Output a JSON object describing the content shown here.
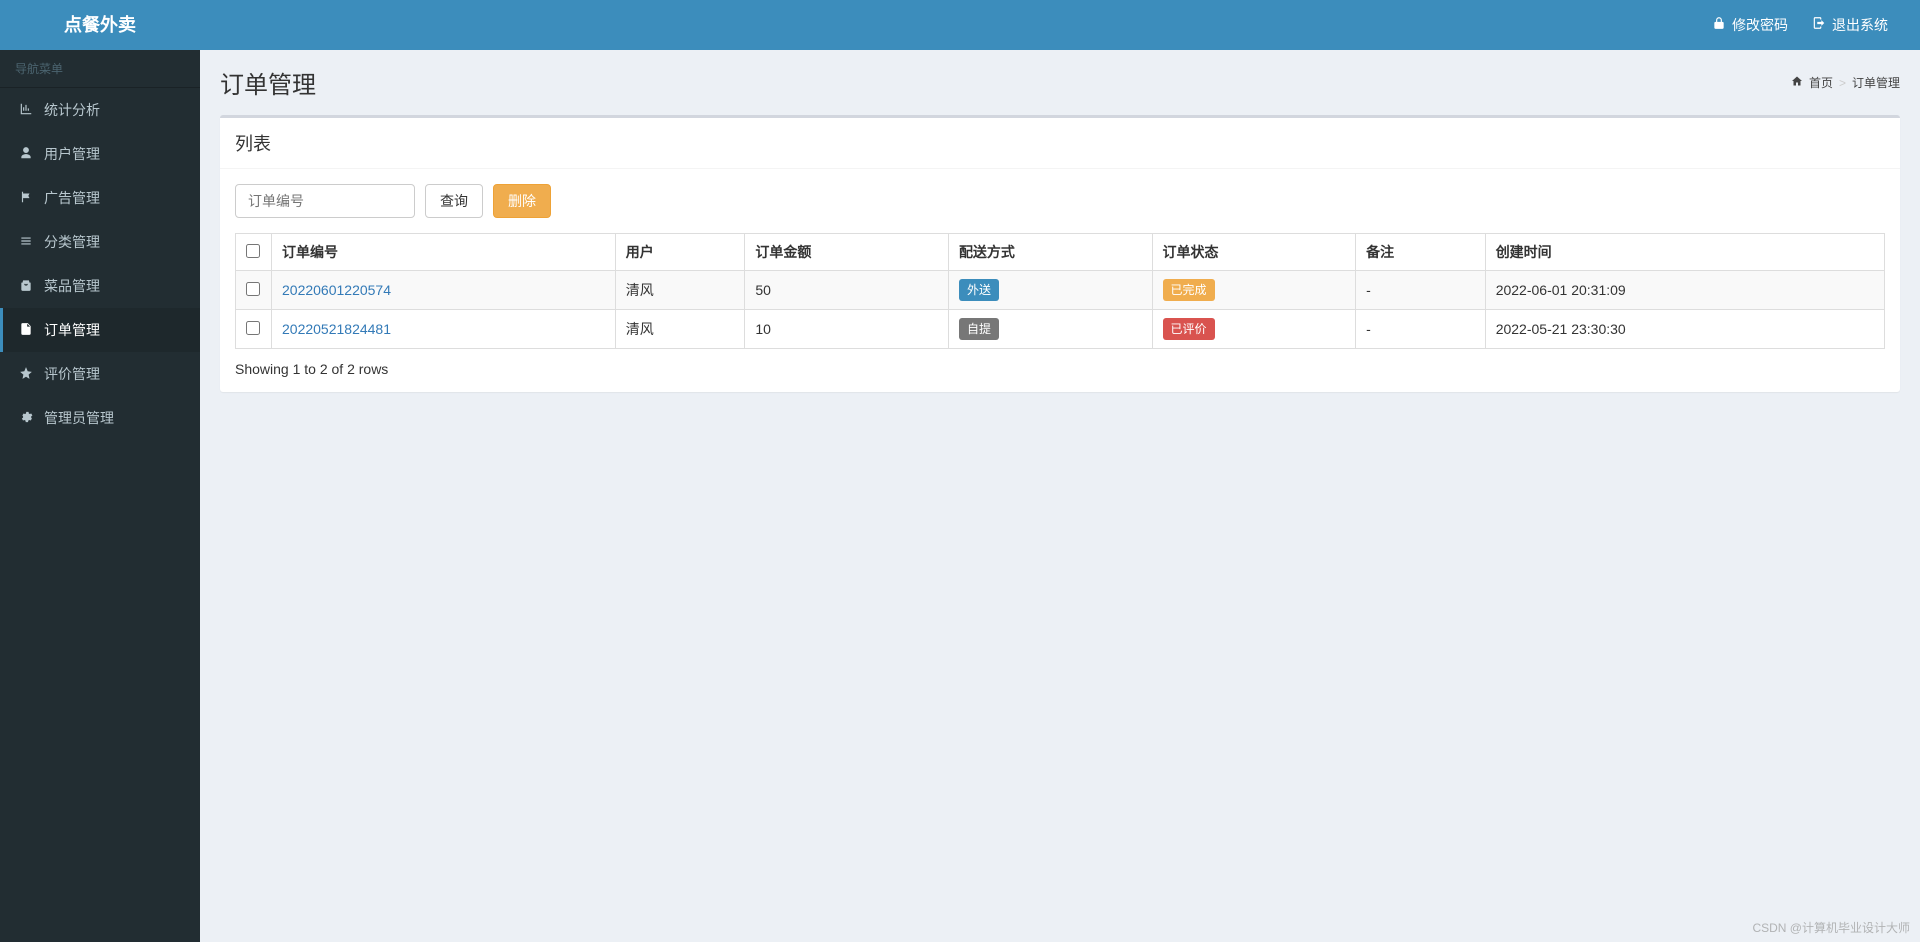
{
  "header": {
    "logo": "点餐外卖",
    "change_password": "修改密码",
    "logout": "退出系统"
  },
  "sidebar": {
    "title": "导航菜单",
    "items": [
      {
        "icon": "bar-chart",
        "label": "统计分析",
        "active": false
      },
      {
        "icon": "user",
        "label": "用户管理",
        "active": false
      },
      {
        "icon": "flag",
        "label": "广告管理",
        "active": false
      },
      {
        "icon": "list",
        "label": "分类管理",
        "active": false
      },
      {
        "icon": "shopping-bag",
        "label": "菜品管理",
        "active": false
      },
      {
        "icon": "file",
        "label": "订单管理",
        "active": true
      },
      {
        "icon": "star",
        "label": "评价管理",
        "active": false
      },
      {
        "icon": "cog",
        "label": "管理员管理",
        "active": false
      }
    ]
  },
  "page": {
    "title": "订单管理",
    "breadcrumb_home": "首页",
    "breadcrumb_current": "订单管理"
  },
  "panel": {
    "title": "列表"
  },
  "controls": {
    "search_placeholder": "订单编号",
    "query_label": "查询",
    "delete_label": "删除"
  },
  "table": {
    "columns": [
      "订单编号",
      "用户",
      "订单金额",
      "配送方式",
      "订单状态",
      "备注",
      "创建时间"
    ],
    "rows": [
      {
        "order_no": "20220601220574",
        "user": "清风",
        "amount": "50",
        "delivery": {
          "text": "外送",
          "style": "info"
        },
        "status": {
          "text": "已完成",
          "style": "warning"
        },
        "remark": "-",
        "created": "2022-06-01 20:31:09"
      },
      {
        "order_no": "20220521824481",
        "user": "清风",
        "amount": "10",
        "delivery": {
          "text": "自提",
          "style": "default"
        },
        "status": {
          "text": "已评价",
          "style": "danger"
        },
        "remark": "-",
        "created": "2022-05-21 23:30:30"
      }
    ],
    "pagination_info": "Showing 1 to 2 of 2 rows"
  },
  "watermark": "CSDN @计算机毕业设计大师"
}
